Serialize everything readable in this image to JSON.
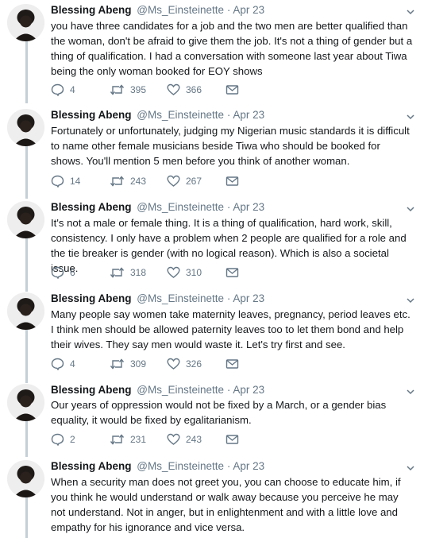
{
  "thread": {
    "author_name": "Blessing Abeng",
    "author_handle": "@Ms_Einsteinette",
    "separator": "·",
    "tweets": [
      {
        "date": "Apr 23",
        "text": "you have three candidates for a job and the two men are better qualified than the woman, don't be afraid to give them the job. It's not a thing of gender but a thing of qualification. I had a conversation with someone last year about Tiwa being the only woman booked for EOY shows",
        "replies": "4",
        "retweets": "395",
        "likes": "366"
      },
      {
        "date": "Apr 23",
        "text": "Fortunately or unfortunately, judging my Nigerian music standards it is difficult to name other female musicians beside Tiwa who should be booked for shows. You'll mention 5 men before you think of another woman.",
        "replies": "14",
        "retweets": "243",
        "likes": "267"
      },
      {
        "date": "Apr 23",
        "text": "It's not a male or female thing. It is a thing of qualification, hard work, skill, consistency. I only have a problem when 2 people are qualified for a role and the tie breaker is gender (with no logical reason). Which is also a societal issue.",
        "replies": "6",
        "retweets": "318",
        "likes": "310"
      },
      {
        "date": "Apr 23",
        "text": "Many people say women take maternity leaves, pregnancy, period leaves etc. I think men should be allowed paternity leaves too to let them bond and help their wives. They say men would waste it. Let's try first and see.",
        "replies": "4",
        "retweets": "309",
        "likes": "326"
      },
      {
        "date": "Apr 23",
        "text": "Our years of oppression would not be fixed by a March, or a gender bias equality, it would be fixed by egalitarianism.",
        "replies": "2",
        "retweets": "231",
        "likes": "243"
      },
      {
        "date": "Apr 23",
        "text": "When a security man does not greet you, you can choose to educate him, if you think he would understand or walk away because you perceive he may not understand. Not in anger, but in enlightenment and with a little love and empathy for his ignorance and vice versa.",
        "replies": "",
        "retweets": "",
        "likes": ""
      }
    ]
  },
  "icons": {
    "reply": "reply-icon",
    "retweet": "retweet-icon",
    "like": "heart-icon",
    "dm": "mail-icon",
    "more": "chevron-down-icon",
    "avatar": "avatar"
  },
  "colors": {
    "thread_line": "#c4cfd6",
    "meta_text": "#657786",
    "body_text": "#14171a"
  }
}
